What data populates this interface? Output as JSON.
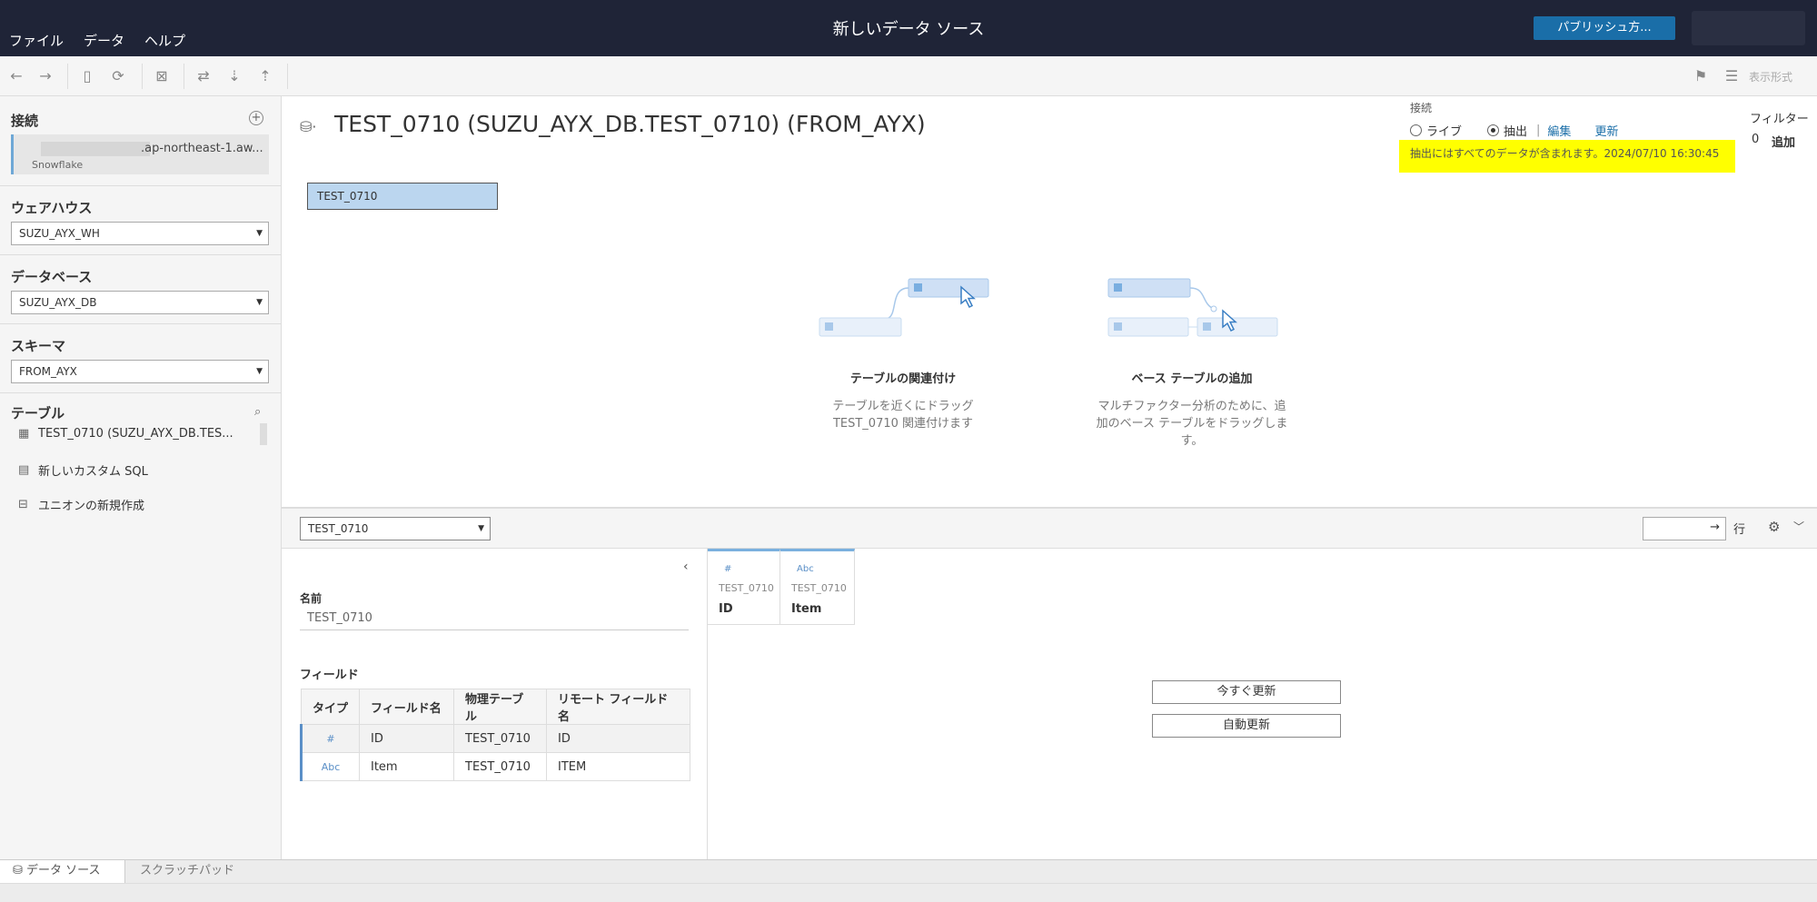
{
  "menu": {
    "items": [
      "ファイル",
      "データ",
      "ヘルプ"
    ]
  },
  "app_title": "新しいデータ ソース",
  "publish_label": "パブリッシュ方...",
  "toolbar": {
    "view_format": "表示形式"
  },
  "sidebar": {
    "connections_title": "接続",
    "connection": {
      "host": ".ap-northeast-1.aw...",
      "type": "Snowflake"
    },
    "warehouse_title": "ウェアハウス",
    "warehouse_value": "SUZU_AYX_WH",
    "database_title": "データベース",
    "database_value": "SUZU_AYX_DB",
    "schema_title": "スキーマ",
    "schema_value": "FROM_AYX",
    "tables_title": "テーブル",
    "tables": [
      {
        "label": "TEST_0710 (SUZU_AYX_DB.TES..."
      },
      {
        "label": "新しいカスタム SQL"
      },
      {
        "label": "ユニオンの新規作成"
      }
    ]
  },
  "main": {
    "datasource_title": "TEST_0710 (SUZU_AYX_DB.TEST_0710) (FROM_AYX)",
    "connection_label": "接続",
    "live_label": "ライブ",
    "extract_label": "抽出",
    "edit_label": "編集",
    "refresh_label": "更新",
    "extract_note": "抽出にはすべてのデータが含まれます。2024/07/10 16:30:45",
    "filter_label": "フィルター",
    "filter_count": "0",
    "filter_add": "追加",
    "table_box": "TEST_0710",
    "hint_relate_title": "テーブルの関連付け",
    "hint_relate_desc": "テーブルを近くにドラッグ TEST_0710 関連付けます",
    "hint_base_title": "ベース テーブルの追加",
    "hint_base_desc": "マルチファクター分析のために、追加のベース テーブルをドラッグします。"
  },
  "meta": {
    "table_select": "TEST_0710",
    "rows_suffix": "行",
    "name_label": "名前",
    "name_value": "TEST_0710",
    "fields_label": "フィールド",
    "columns": [
      "タイプ",
      "フィールド名",
      "物理テーブル",
      "リモート フィールド名"
    ],
    "rows": [
      {
        "type": "#",
        "name": "ID",
        "table": "TEST_0710",
        "remote": "ID"
      },
      {
        "type": "Abc",
        "name": "Item",
        "table": "TEST_0710",
        "remote": "ITEM"
      }
    ]
  },
  "grid": {
    "columns": [
      {
        "type": "#",
        "table": "TEST_0710",
        "field": "ID"
      },
      {
        "type": "Abc",
        "table": "TEST_0710",
        "field": "Item"
      }
    ],
    "update_now": "今すぐ更新",
    "auto_update": "自動更新"
  },
  "tabs": {
    "data_source": "データ ソース",
    "scratchpad": "スクラッチパッド"
  },
  "colors": {
    "topbar": "#1f2437",
    "publish": "#1a6ea8",
    "highlight": "#ffff00",
    "table_box": "#bbd6ef"
  }
}
